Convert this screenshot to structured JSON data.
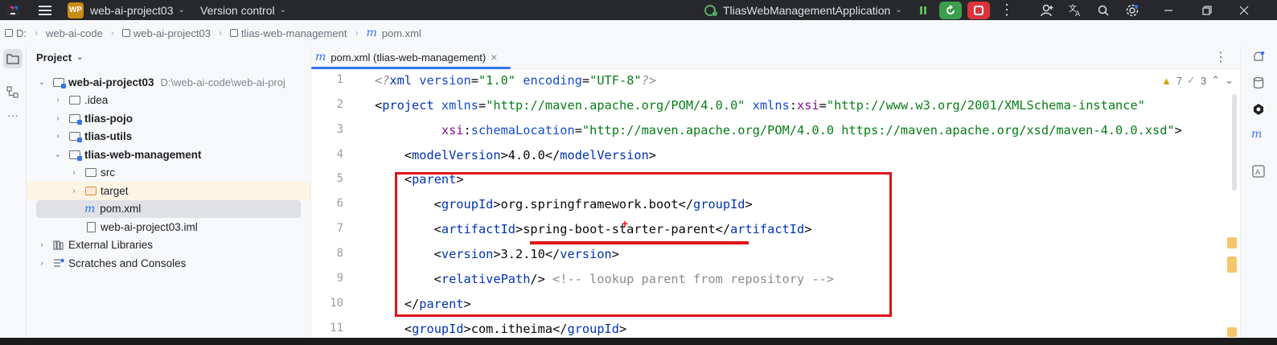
{
  "titlebar": {
    "project_badge": "WP",
    "project_name": "web-ai-project03",
    "vcs_label": "Version control",
    "run_config": "TliasWebManagementApplication"
  },
  "breadcrumb": [
    "D:",
    "web-ai-code",
    "web-ai-project03",
    "tlias-web-management",
    "pom.xml"
  ],
  "project_panel": {
    "title": "Project",
    "tree": [
      {
        "label": "web-ai-project03",
        "hint": "D:\\web-ai-code\\web-ai-proj"
      },
      {
        "label": ".idea"
      },
      {
        "label": "tlias-pojo"
      },
      {
        "label": "tlias-utils"
      },
      {
        "label": "tlias-web-management"
      },
      {
        "label": "src"
      },
      {
        "label": "target"
      },
      {
        "label": "pom.xml"
      },
      {
        "label": "web-ai-project03.iml"
      },
      {
        "label": "External Libraries"
      },
      {
        "label": "Scratches and Consoles"
      }
    ]
  },
  "editor": {
    "tab_label": "pom.xml (tlias-web-management)",
    "tab_close": "×",
    "warnings_count": "7",
    "weak_warnings_count": "3",
    "line_numbers": [
      "1",
      "2",
      "3",
      "4",
      "5",
      "6",
      "7",
      "8",
      "9",
      "10",
      "11"
    ],
    "code": {
      "l1_open": "<?",
      "l1_xml": "xml ",
      "l1_version_attr": "version",
      "l1_version_val": "\"1.0\"",
      "l1_encoding_attr": "encoding",
      "l1_encoding_val": "\"UTF-8\"",
      "l1_close": "?>",
      "l2_tag": "project",
      "l2_xmlns_attr": "xmlns",
      "l2_xmlns_val": "\"http://maven.apache.org/POM/4.0.0\"",
      "l2_xsi_prefix": "xmlns",
      "l2_xsi_name": "xsi",
      "l2_xsi_val": "\"http://www.w3.org/2001/XMLSchema-instance\"",
      "l3_prefix": "xsi",
      "l3_attr": "schemaLocation",
      "l3_val": "\"http://maven.apache.org/POM/4.0.0 https://maven.apache.org/xsd/maven-4.0.0.xsd\"",
      "l4_tag": "modelVersion",
      "l4_val": "4.0.0",
      "l5_tag": "parent",
      "l6_tag": "groupId",
      "l6_val": "org.springframework.boot",
      "l7_tag": "artifactId",
      "l7_val": "spring-boot-starter-parent",
      "l8_tag": "version",
      "l8_val": "3.2.10",
      "l9_tag": "relativePath",
      "l9_comment": "<!-- lookup parent from repository -->",
      "l10_tag": "parent",
      "l11_tag": "groupId",
      "l11_val": "com.itheima"
    }
  },
  "annotation": {
    "plus_symbol": "+",
    "color": "#e0121a"
  },
  "colors": {
    "accent": "#3574f0",
    "titlebar_bg": "#27282c",
    "run_green": "#3b9e4c",
    "stop_red": "#d9343e"
  }
}
